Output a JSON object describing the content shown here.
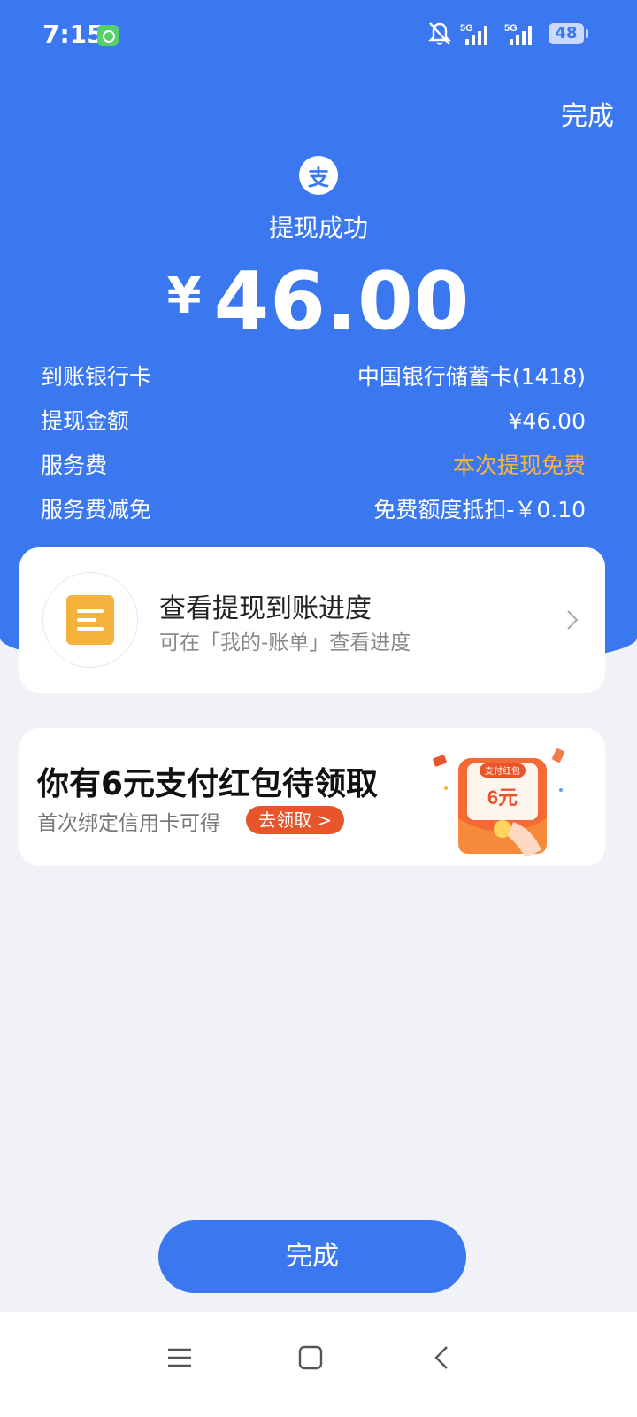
{
  "status_bar": {
    "time": "7:15",
    "network_1": "5G",
    "network_2": "5G",
    "battery": "48"
  },
  "header": {
    "done_label": "完成",
    "logo_char": "支",
    "title": "提现成功",
    "currency": "¥",
    "amount": "46.00"
  },
  "details": [
    {
      "label": "到账银行卡",
      "value": "中国银行储蓄卡(1418)",
      "value_color": "#ffffff"
    },
    {
      "label": "提现金额",
      "value": "¥46.00",
      "value_color": "#ffffff"
    },
    {
      "label": "服务费",
      "value": "本次提现免费",
      "value_color": "#f5b53f"
    },
    {
      "label": "服务费减免",
      "value": "免费额度抵扣-￥0.10",
      "value_color": "#ffffff"
    }
  ],
  "progress_card": {
    "icon": "document-list-icon",
    "title": "查看提现到账进度",
    "subtitle": "可在「我的-账单」查看进度"
  },
  "promo_card": {
    "title": "你有6元支付红包待领取",
    "subtitle": "首次绑定信用卡可得",
    "button_label": "去领取 >",
    "packet_label": "支付红包",
    "packet_amount": "6元"
  },
  "footer": {
    "done_label": "完成"
  },
  "colors": {
    "brand_blue": "#3b78f0",
    "accent_orange": "#f5b53f",
    "claim_red": "#e8552b"
  }
}
